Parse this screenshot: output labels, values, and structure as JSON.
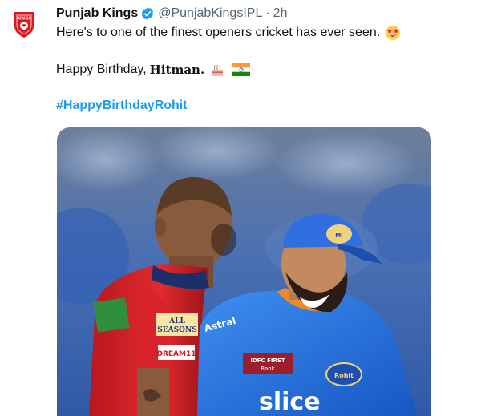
{
  "tweet": {
    "author_name": "Punjab Kings",
    "handle": "@PunjabKingsIPL",
    "separator": "·",
    "time": "2h",
    "line1": "Here's to one of the finest openers cricket has ever seen.",
    "line2_prefix": "Happy Birthday,",
    "line2_name": "Hitman.",
    "hashtag": "#HappyBirthdayRohit"
  },
  "media": {
    "jersey_left_sponsor1": "ALL SEASONS",
    "jersey_left_sponsor2": "DREAM11",
    "jersey_right_sponsor1": "IDFC FIRST Bank",
    "jersey_right_sponsor2": "slice",
    "jersey_right_text": "Rohit",
    "jersey_right_shoulder": "Astral"
  },
  "icons": {
    "avatar": "punjab-kings-logo",
    "verified": "verified-badge-icon",
    "emoji1": "star-struck-emoji",
    "emoji2": "birthday-cake-emoji",
    "emoji3": "india-flag-emoji"
  },
  "colors": {
    "brand_red": "#d71920",
    "link": "#1d9bf0",
    "verified": "#1d9bf0",
    "muted": "#536471"
  }
}
